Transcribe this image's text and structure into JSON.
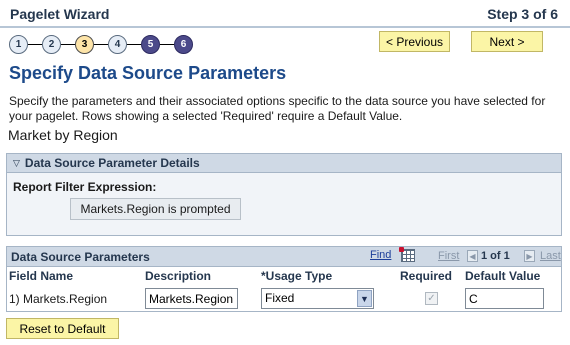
{
  "header": {
    "title": "Pagelet Wizard",
    "step": "Step 3 of 6"
  },
  "stepper": {
    "steps": [
      {
        "label": "1",
        "state": "completed"
      },
      {
        "label": "2",
        "state": "completed"
      },
      {
        "label": "3",
        "state": "current"
      },
      {
        "label": "4",
        "state": "completed"
      },
      {
        "label": "5",
        "state": "future"
      },
      {
        "label": "6",
        "state": "future"
      }
    ]
  },
  "buttons": {
    "previous": "< Previous",
    "next": "Next >",
    "reset": "Reset to Default"
  },
  "page": {
    "title": "Specify Data Source Parameters",
    "description": "Specify the parameters and their associated options specific to the data source you have selected for your pagelet.  Rows showing a selected 'Required' require a Default Value.",
    "subheading": "Market by Region"
  },
  "details": {
    "title": "Data Source Parameter Details",
    "filter_label": "Report Filter Expression:",
    "filter_value": "Markets.Region is prompted"
  },
  "grid": {
    "title": "Data Source Parameters",
    "find": "Find",
    "first": "First",
    "pager": "1 of 1",
    "last": "Last",
    "columns": {
      "field_name": "Field Name",
      "description": "Description",
      "usage_type": "*Usage Type",
      "required": "Required",
      "default_value": "Default Value"
    },
    "rows": [
      {
        "field_name": "1) Markets.Region",
        "description": "Markets.Region",
        "usage_type": "Fixed",
        "required": true,
        "default_value": "C"
      }
    ]
  },
  "colors": {
    "accent_title": "#1d4a8a",
    "button_bg": "#fbf5a6",
    "header_bg": "#cfd9e5"
  }
}
